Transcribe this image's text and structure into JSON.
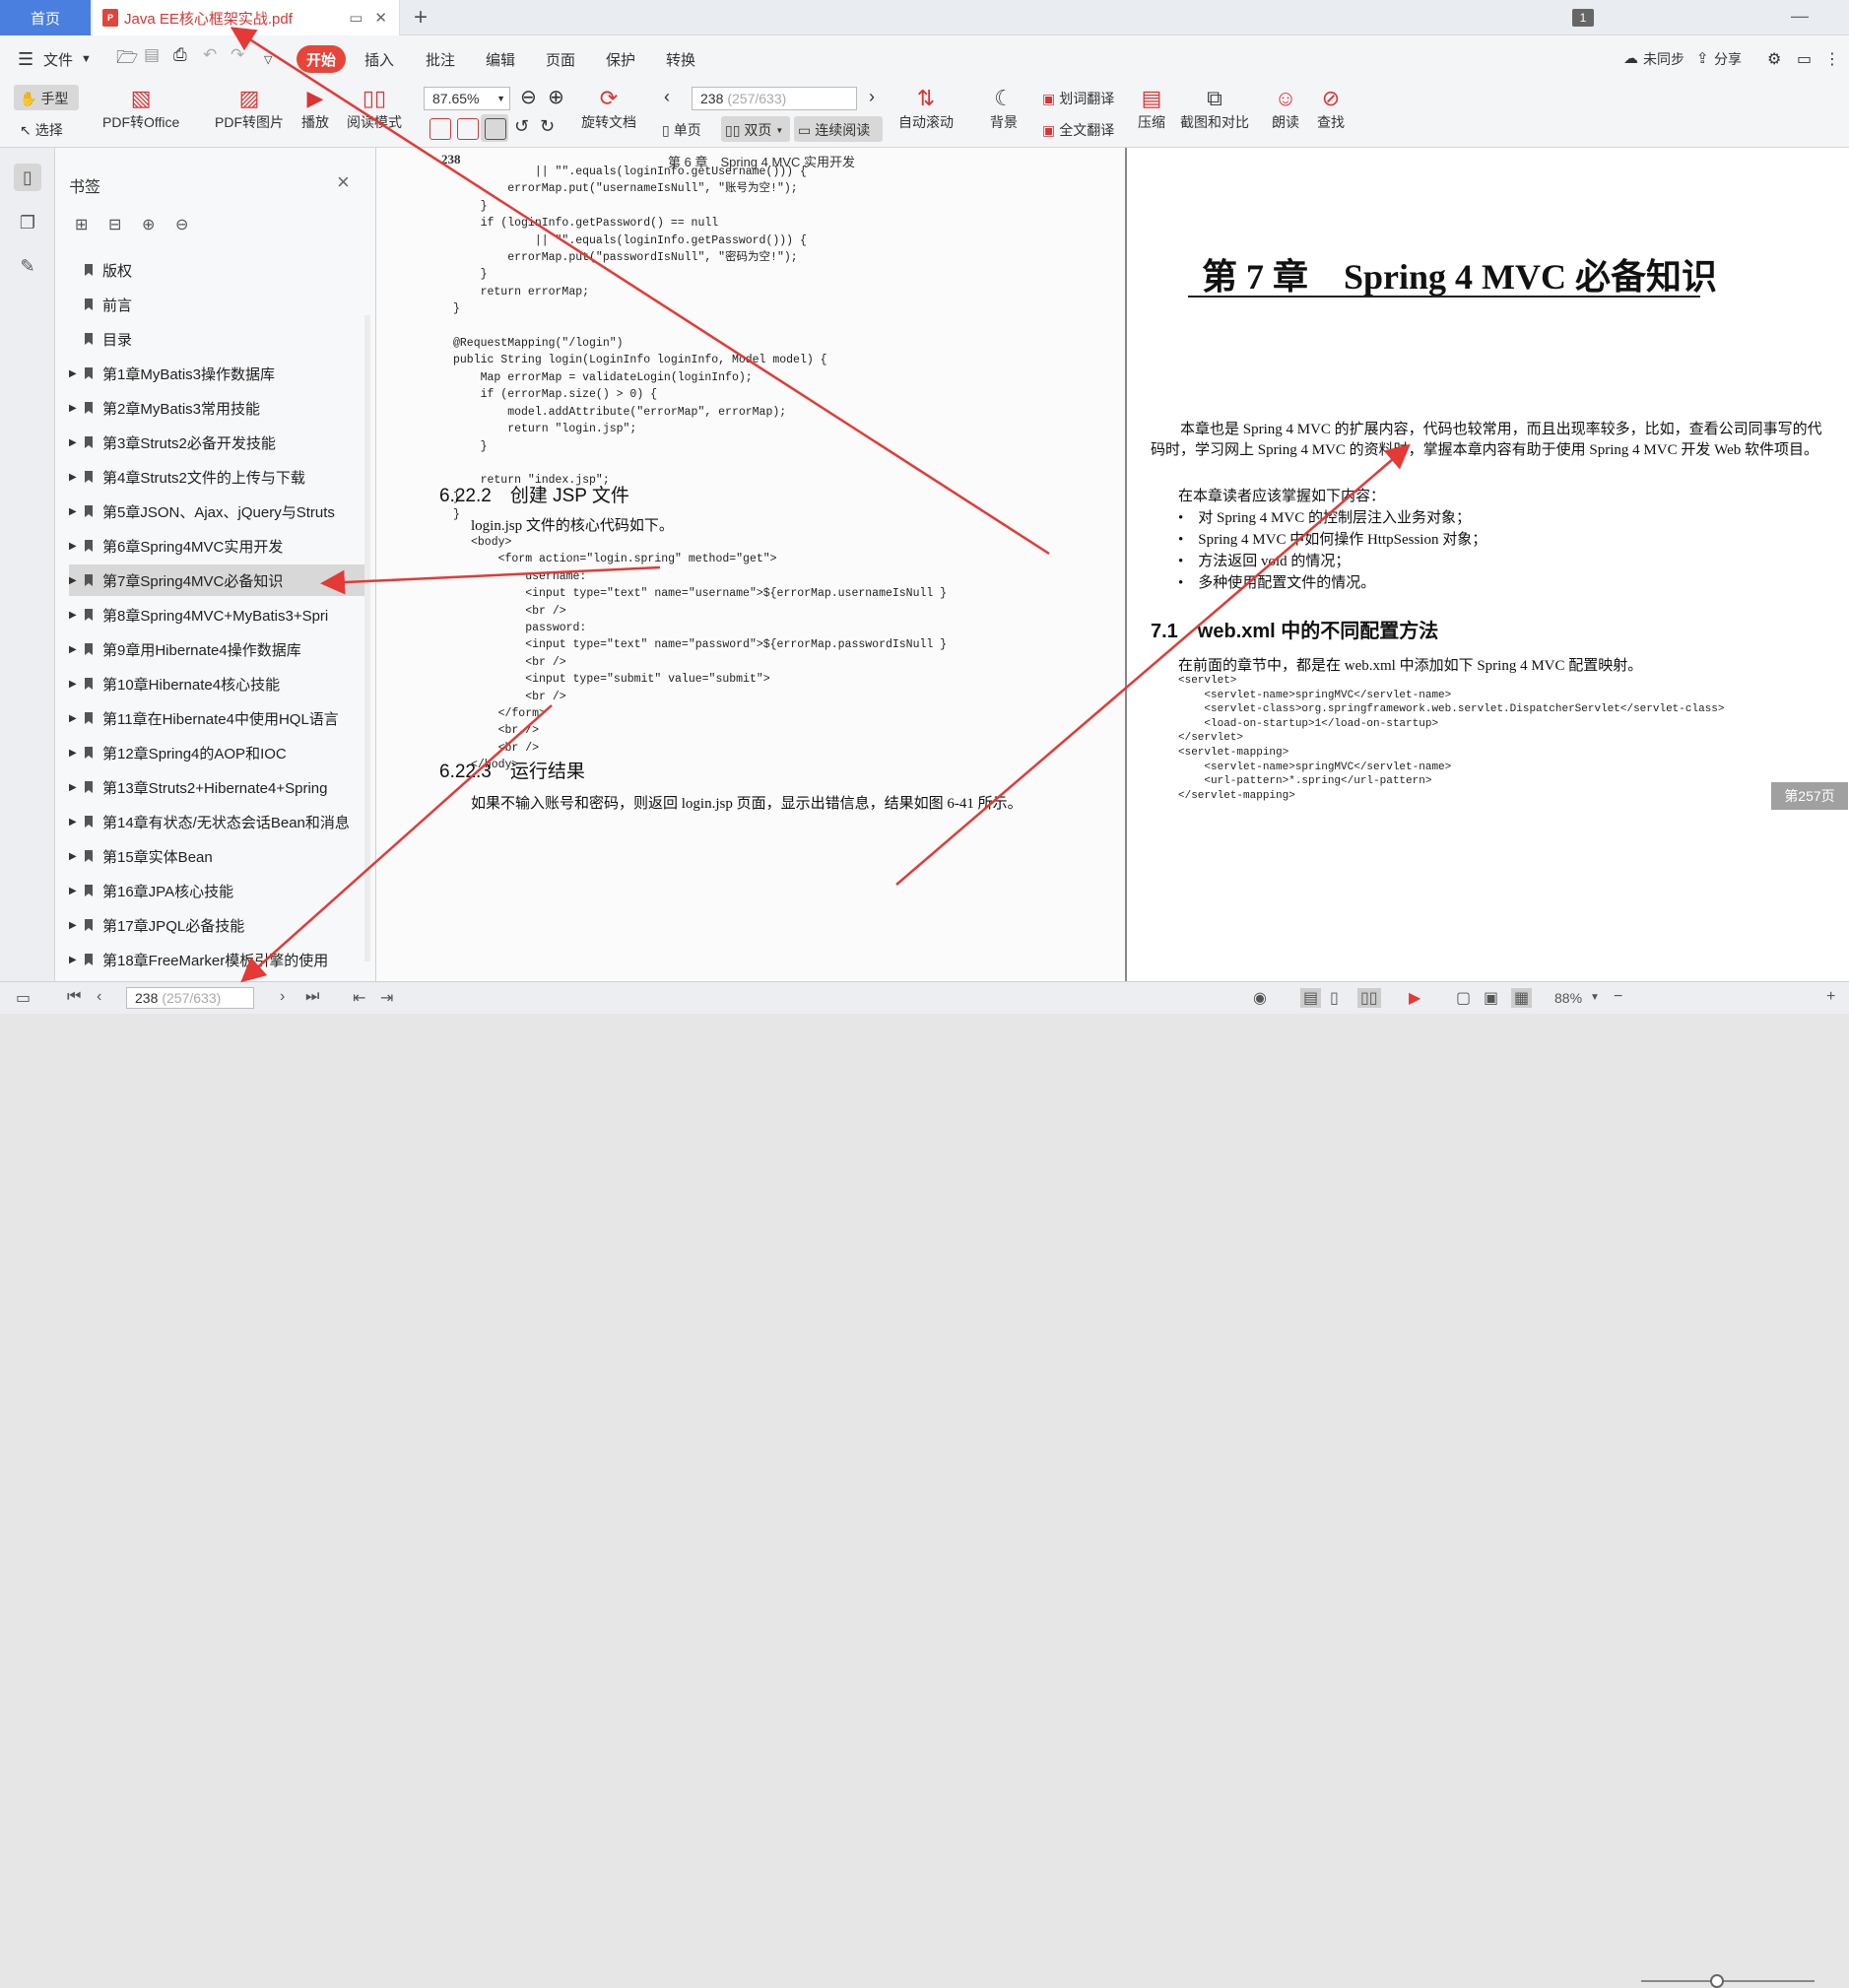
{
  "tabs": {
    "home": "首页",
    "doc_title": "Java EE核心框架实战.pdf",
    "window_count": "1"
  },
  "menu": {
    "file": "文件",
    "items": [
      "开始",
      "插入",
      "批注",
      "编辑",
      "页面",
      "保护",
      "转换"
    ],
    "sync": "未同步",
    "share": "分享"
  },
  "toolbar": {
    "hand": "手型",
    "select": "选择",
    "pdf_to_office": "PDF转Office",
    "pdf_to_image": "PDF转图片",
    "play": "播放",
    "read_mode": "阅读模式",
    "zoom": "87.65%",
    "rotate": "旋转文档",
    "page_current": "238",
    "page_total": "(257/633)",
    "single": "单页",
    "double": "双页",
    "continuous": "连续阅读",
    "autoscroll": "自动滚动",
    "background": "背景",
    "word_translate": "划词翻译",
    "full_translate": "全文翻译",
    "compress": "压缩",
    "screenshot_compare": "截图和对比",
    "read_aloud": "朗读",
    "find": "查找"
  },
  "panel": {
    "title": "书签",
    "bookmarks": [
      {
        "label": "版权",
        "expandable": false
      },
      {
        "label": "前言",
        "expandable": false
      },
      {
        "label": "目录",
        "expandable": false
      },
      {
        "label": "第1章MyBatis3操作数据库",
        "expandable": true
      },
      {
        "label": "第2章MyBatis3常用技能",
        "expandable": true
      },
      {
        "label": "第3章Struts2必备开发技能",
        "expandable": true
      },
      {
        "label": "第4章Struts2文件的上传与下载",
        "expandable": true
      },
      {
        "label": "第5章JSON、Ajax、jQuery与Struts",
        "expandable": true
      },
      {
        "label": "第6章Spring4MVC实用开发",
        "expandable": true
      },
      {
        "label": "第7章Spring4MVC必备知识",
        "expandable": true,
        "selected": true
      },
      {
        "label": "第8章Spring4MVC+MyBatis3+Spri",
        "expandable": true
      },
      {
        "label": "第9章用Hibernate4操作数据库",
        "expandable": true
      },
      {
        "label": "第10章Hibernate4核心技能",
        "expandable": true
      },
      {
        "label": "第11章在Hibernate4中使用HQL语言",
        "expandable": true
      },
      {
        "label": "第12章Spring4的AOP和IOC",
        "expandable": true
      },
      {
        "label": "第13章Struts2+Hibernate4+Spring",
        "expandable": true
      },
      {
        "label": "第14章有状态/无状态会话Bean和消息",
        "expandable": true
      },
      {
        "label": "第15章实体Bean",
        "expandable": true
      },
      {
        "label": "第16章JPA核心技能",
        "expandable": true
      },
      {
        "label": "第17章JPQL必备技能",
        "expandable": true
      },
      {
        "label": "第18章FreeMarker模板引擎的使用",
        "expandable": true
      }
    ]
  },
  "left_page": {
    "page_number": "238",
    "running_header": "第 6 章　Spring 4 MVC 实用开发",
    "code1": "            || \"\".equals(loginInfo.getUsername())) {\n        errorMap.put(\"usernameIsNull\", \"账号为空!\");\n    }\n    if (loginInfo.getPassword() == null\n            || \"\".equals(loginInfo.getPassword())) {\n        errorMap.put(\"passwordIsNull\", \"密码为空!\");\n    }\n    return errorMap;\n}\n\n@RequestMapping(\"/login\")\npublic String login(LoginInfo loginInfo, Model model) {\n    Map errorMap = validateLogin(loginInfo);\n    if (errorMap.size() > 0) {\n        model.addAttribute(\"errorMap\", errorMap);\n        return \"login.jsp\";\n    }\n\n    return \"index.jsp\";\n}\n}",
    "section1_title": "6.22.2　创建 JSP 文件",
    "section1_intro": "login.jsp 文件的核心代码如下。",
    "code2": "<body>\n    <form action=\"login.spring\" method=\"get\">\n        username:\n        <input type=\"text\" name=\"username\">${errorMap.usernameIsNull }\n        <br />\n        password:\n        <input type=\"text\" name=\"password\">${errorMap.passwordIsNull }\n        <br />\n        <input type=\"submit\" value=\"submit\">\n        <br />\n    </form>\n    <br />\n    <br />\n</body>",
    "section2_title": "6.22.3　运行结果",
    "section2_text": "如果不输入账号和密码，则返回 login.jsp 页面，显示出错信息，结果如图 6-41 所示。"
  },
  "right_page": {
    "chapter_title": "第 7 章　Spring 4 MVC 必备知识",
    "para1": "本章也是 Spring 4 MVC 的扩展内容，代码也较常用，而且出现率较多，比如，查看公司同事写的代码时，学习网上 Spring 4 MVC 的资料时，掌握本章内容有助于使用 Spring 4 MVC 开发 Web 软件项目。",
    "para2": "在本章读者应该掌握如下内容：",
    "bullets": [
      "对 Spring 4 MVC 的控制层注入业务对象；",
      "Spring 4 MVC 中如何操作 HttpSession 对象；",
      "方法返回 void 的情况；",
      "多种使用配置文件的情况。"
    ],
    "section_title": "7.1　web.xml 中的不同配置方法",
    "section_intro": "在前面的章节中，都是在 web.xml 中添加如下 Spring 4 MVC 配置映射。",
    "code": "<servlet>\n    <servlet-name>springMVC</servlet-name>\n    <servlet-class>org.springframework.web.servlet.DispatcherServlet</servlet-class>\n    <load-on-startup>1</load-on-startup>\n</servlet>\n<servlet-mapping>\n    <servlet-name>springMVC</servlet-name>\n    <url-pattern>*.spring</url-pattern>\n</servlet-mapping>",
    "page_badge": "第257页"
  },
  "statusbar": {
    "page_current": "238",
    "page_total": "(257/633)",
    "zoom": "88%"
  },
  "colors": {
    "accent": "#e8453a",
    "home_tab": "#4a7fe0",
    "annotation": "#e53935"
  }
}
